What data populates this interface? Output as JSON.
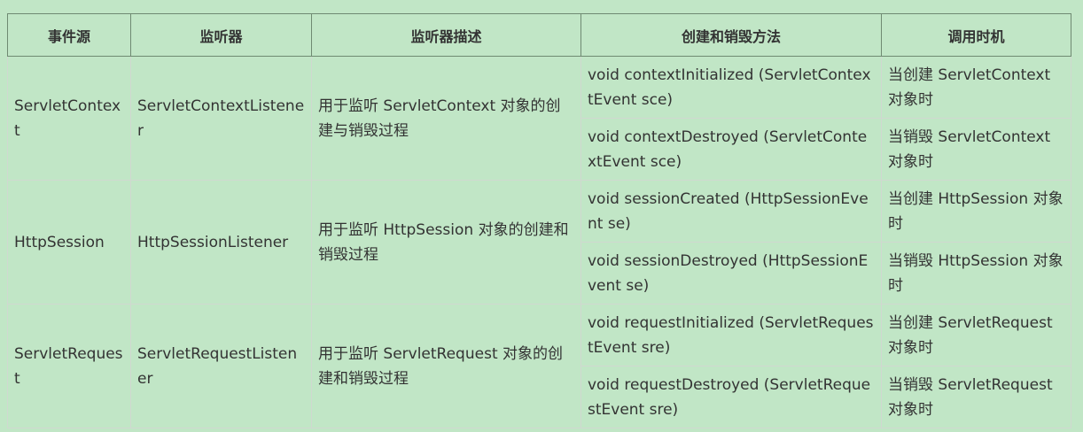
{
  "headers": [
    "事件源",
    "监听器",
    "监听器描述",
    "创建和销毁方法",
    "调用时机"
  ],
  "rows": [
    {
      "source": "ServletContext",
      "listener": "ServletContextListener",
      "desc": "用于监听 ServletContext 对象的创建与销毁过程",
      "methods": [
        {
          "method": "void contextInitialized (ServletContextEvent sce)",
          "timing": "当创建 ServletContext 对象时"
        },
        {
          "method": "void contextDestroyed (ServletContextEvent sce)",
          "timing": "当销毁 ServletContext 对象时"
        }
      ]
    },
    {
      "source": "HttpSession",
      "listener": "HttpSessionListener",
      "desc": "用于监听 HttpSession 对象的创建和销毁过程",
      "methods": [
        {
          "method": "void sessionCreated (HttpSessionEvent se)",
          "timing": "当创建 HttpSession 对象时"
        },
        {
          "method": "void sessionDestroyed (HttpSessionEvent se)",
          "timing": "当销毁 HttpSession 对象时"
        }
      ]
    },
    {
      "source": "ServletRequest",
      "listener": "ServletRequestListener",
      "desc": "用于监听 ServletRequest 对象的创建和销毁过程",
      "methods": [
        {
          "method": "void requestInitialized (ServletRequestEvent sre)",
          "timing": "当创建 ServletRequest 对象时"
        },
        {
          "method": "void requestDestroyed (ServletRequestEvent sre)",
          "timing": "当销毁 ServletRequest 对象时"
        }
      ]
    }
  ]
}
